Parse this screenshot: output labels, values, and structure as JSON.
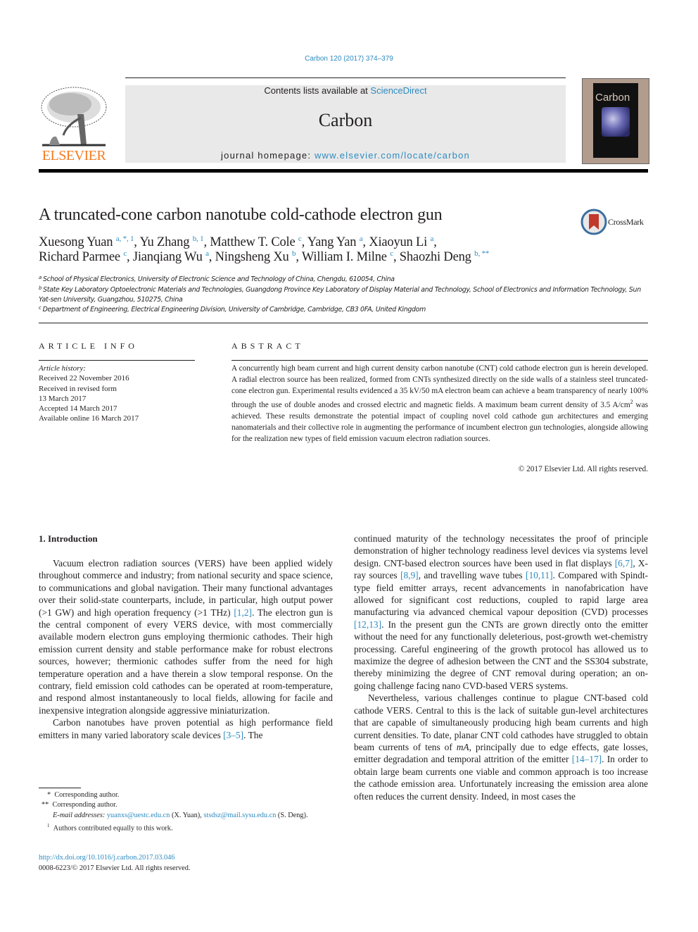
{
  "header": {
    "journal_ref": "Carbon 120 (2017) 374–379",
    "contents_prefix": "Contents lists available at ",
    "contents_link": "ScienceDirect",
    "journal_name": "Carbon",
    "homepage_prefix": "journal homepage: ",
    "homepage_link": "www.elsevier.com/locate/carbon",
    "publisher_logo_text": "ELSEVIER",
    "cover_title": "Carbon",
    "publisher_color": "#f47b20",
    "link_color": "#2e8bc0"
  },
  "article": {
    "title": "A truncated-cone carbon nanotube cold-cathode electron gun",
    "crossmark_label": "CrossMark",
    "authors_line1": [
      {
        "name": "Xuesong Yuan",
        "sup": "a, *, 1"
      },
      {
        "name": "Yu Zhang",
        "sup": "b, 1"
      },
      {
        "name": "Matthew T. Cole",
        "sup": "c"
      },
      {
        "name": "Yang Yan",
        "sup": "a"
      },
      {
        "name": "Xiaoyun Li",
        "sup": "a"
      }
    ],
    "authors_line2": [
      {
        "name": "Richard Parmee",
        "sup": "c"
      },
      {
        "name": "Jianqiang Wu",
        "sup": "a"
      },
      {
        "name": "Ningsheng Xu",
        "sup": "b"
      },
      {
        "name": "William I. Milne",
        "sup": "c"
      },
      {
        "name": "Shaozhi Deng",
        "sup": "b, **"
      }
    ],
    "affiliations": [
      {
        "key": "a",
        "text": "School of Physical Electronics, University of Electronic Science and Technology of China, Chengdu, 610054, China"
      },
      {
        "key": "b",
        "text": "State Key Laboratory Optoelectronic Materials and Technologies, Guangdong Province Key Laboratory of Display Material and Technology, School of Electronics and Information Technology, Sun Yat-sen University, Guangzhou, 510275, China"
      },
      {
        "key": "c",
        "text": "Department of Engineering, Electrical Engineering Division, University of Cambridge, Cambridge, CB3 0FA, United Kingdom"
      }
    ]
  },
  "article_info": {
    "heading": "ARTICLE INFO",
    "history_label": "Article history:",
    "history": [
      "Received 22 November 2016",
      "Received in revised form",
      "13 March 2017",
      "Accepted 14 March 2017",
      "Available online 16 March 2017"
    ]
  },
  "abstract": {
    "heading": "ABSTRACT",
    "text_before_sup": "A concurrently high beam current and high current density carbon nanotube (CNT) cold cathode electron gun is herein developed. A radial electron source has been realized, formed from CNTs synthesized directly on the side walls of a stainless steel truncated-cone electron gun. Experimental results evidenced a 35 kV/50 mA electron beam can achieve a beam transparency of nearly 100% through the use of double anodes and crossed electric and magnetic fields. A maximum beam current density of 3.5 A/cm",
    "sup": "2",
    "text_after_sup": " was achieved. These results demonstrate the potential impact of coupling novel cold cathode gun architectures and emerging nanomaterials and their collective role in augmenting the performance of incumbent electron gun technologies, alongside allowing for the realization new types of field emission vacuum electron radiation sources.",
    "copyright": "© 2017 Elsevier Ltd. All rights reserved."
  },
  "body": {
    "section_heading": "1.  Introduction",
    "left_p1_a": "Vacuum electron radiation sources (VERS) have been applied widely throughout commerce and industry; from national security and space science, to communications and global navigation. Their many functional advantages over their solid-state counterparts, include, in particular, high output power (>1 GW) and high operation frequency (>1 THz) ",
    "left_p1_cite": "[1,2]",
    "left_p1_b": ". The electron gun is the central component of every VERS device, with most commercially available modern electron guns employing thermionic cathodes. Their high emission current density and stable performance make for robust electrons sources, however; thermionic cathodes suffer from the need for high temperature operation and a have therein a slow temporal response. On the contrary, field emission cold cathodes can be operated at room-temperature, and respond almost instantaneously to local fields, allowing for facile and inexpensive integration alongside aggressive miniaturization.",
    "left_p2_a": "Carbon nanotubes have proven potential as high performance field emitters in many varied laboratory scale devices ",
    "left_p2_cite": "[3–5]",
    "left_p2_b": ". The",
    "right_p1_a": "continued maturity of the technology necessitates the proof of principle demonstration of higher technology readiness level devices via systems level design. CNT-based electron sources have been used in flat displays ",
    "right_p1_cite1": "[6,7]",
    "right_p1_b": ", X-ray sources ",
    "right_p1_cite2": "[8,9]",
    "right_p1_c": ", and travelling wave tubes ",
    "right_p1_cite3": "[10,11]",
    "right_p1_d": ". Compared with Spindt-type field emitter arrays, recent advancements in nanofabrication have allowed for significant cost reductions, coupled to rapid large area manufacturing via advanced chemical vapour deposition (CVD) processes ",
    "right_p1_cite4": "[12,13]",
    "right_p1_e": ". In the present gun the CNTs are grown directly onto the emitter without the need for any functionally deleterious, post-growth wet-chemistry processing. Careful engineering of the growth protocol has allowed us to maximize the degree of adhesion between the CNT and the SS304 substrate, thereby minimizing the degree of CNT removal during operation; an on-going challenge facing nano CVD-based VERS systems.",
    "right_p2_a": "Nevertheless, various challenges continue to plague CNT-based cold cathode VERS. Central to this is the lack of suitable gun-level architectures that are capable of simultaneously producing high beam currents and high current densities. To date, planar CNT cold cathodes have struggled to obtain beam currents of tens of ",
    "right_p2_italic": "mA",
    "right_p2_b": ", principally due to edge effects, gate losses, emitter degradation and temporal attrition of the emitter ",
    "right_p2_cite": "[14–17]",
    "right_p2_c": ". In order to obtain large beam currents one viable and common approach is too increase the cathode emission area. Unfortunately increasing the emission area alone often reduces the current density. Indeed, in most cases the"
  },
  "footnotes": {
    "fn1_mark": "*",
    "fn1_text": "Corresponding author.",
    "fn2_mark": "**",
    "fn2_text": "Corresponding author.",
    "email_label": "E-mail addresses:",
    "email1": "yuanxs@uestc.edu.cn",
    "email1_owner": " (X. Yuan), ",
    "email2": "stsdsz@mail.sysu.edu.cn",
    "email2_owner": " (S. Deng).",
    "fn3_mark": "1",
    "fn3_text": "Authors contributed equally to this work.",
    "doi": "http://dx.doi.org/10.1016/j.carbon.2017.03.046",
    "issn_line": "0008-6223/© 2017 Elsevier Ltd. All rights reserved."
  }
}
